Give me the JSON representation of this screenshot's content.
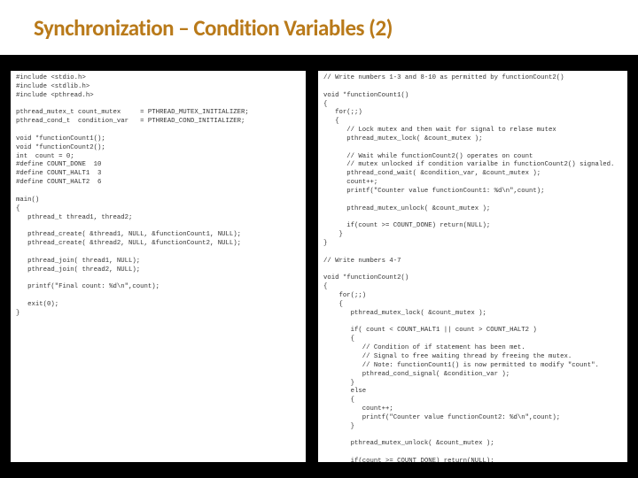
{
  "title": "Synchronization – Condition Variables (2)",
  "code_left": "#include <stdio.h>\n#include <stdlib.h>\n#include <pthread.h>\n\npthread_mutex_t count_mutex     = PTHREAD_MUTEX_INITIALIZER;\npthread_cond_t  condition_var   = PTHREAD_COND_INITIALIZER;\n\nvoid *functionCount1();\nvoid *functionCount2();\nint  count = 0;\n#define COUNT_DONE  10\n#define COUNT_HALT1  3\n#define COUNT_HALT2  6\n\nmain()\n{\n   pthread_t thread1, thread2;\n\n   pthread_create( &thread1, NULL, &functionCount1, NULL);\n   pthread_create( &thread2, NULL, &functionCount2, NULL);\n\n   pthread_join( thread1, NULL);\n   pthread_join( thread2, NULL);\n\n   printf(\"Final count: %d\\n\",count);\n\n   exit(0);\n}",
  "code_right": "// Write numbers 1-3 and 8-10 as permitted by functionCount2()\n\nvoid *functionCount1()\n{\n   for(;;)\n   {\n      // Lock mutex and then wait for signal to relase mutex\n      pthread_mutex_lock( &count_mutex );\n\n      // Wait while functionCount2() operates on count\n      // mutex unlocked if condition varialbe in functionCount2() signaled.\n      pthread_cond_wait( &condition_var, &count_mutex );\n      count++;\n      printf(\"Counter value functionCount1: %d\\n\",count);\n\n      pthread_mutex_unlock( &count_mutex );\n\n      if(count >= COUNT_DONE) return(NULL);\n    }\n}\n\n// Write numbers 4-7\n\nvoid *functionCount2()\n{\n    for(;;)\n    {\n       pthread_mutex_lock( &count_mutex );\n\n       if( count < COUNT_HALT1 || count > COUNT_HALT2 )\n       {\n          // Condition of if statement has been met.\n          // Signal to free waiting thread by freeing the mutex.\n          // Note: functionCount1() is now permitted to modify \"count\".\n          pthread_cond_signal( &condition_var );\n       }\n       else\n       {\n          count++;\n          printf(\"Counter value functionCount2: %d\\n\",count);\n       }\n\n       pthread_mutex_unlock( &count_mutex );\n\n       if(count >= COUNT_DONE) return(NULL);\n    }\n\n}",
  "highlight1_label": "pthread_cond_wait",
  "highlight2_label": "pthread_cond_signal"
}
